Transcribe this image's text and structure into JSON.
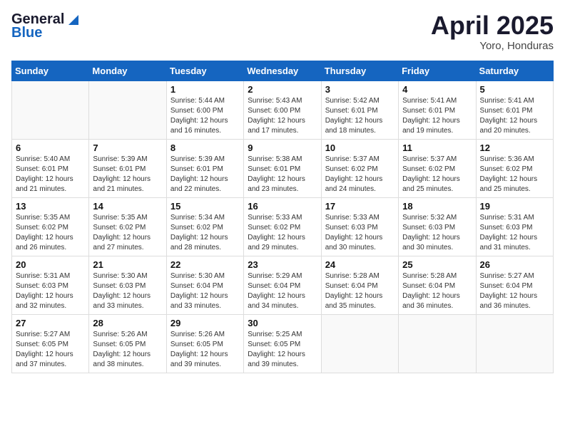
{
  "header": {
    "logo_general": "General",
    "logo_blue": "Blue",
    "month_title": "April 2025",
    "location": "Yoro, Honduras"
  },
  "days_of_week": [
    "Sunday",
    "Monday",
    "Tuesday",
    "Wednesday",
    "Thursday",
    "Friday",
    "Saturday"
  ],
  "weeks": [
    [
      {
        "day": "",
        "content": ""
      },
      {
        "day": "",
        "content": ""
      },
      {
        "day": "1",
        "content": "Sunrise: 5:44 AM\nSunset: 6:00 PM\nDaylight: 12 hours and 16 minutes."
      },
      {
        "day": "2",
        "content": "Sunrise: 5:43 AM\nSunset: 6:00 PM\nDaylight: 12 hours and 17 minutes."
      },
      {
        "day": "3",
        "content": "Sunrise: 5:42 AM\nSunset: 6:01 PM\nDaylight: 12 hours and 18 minutes."
      },
      {
        "day": "4",
        "content": "Sunrise: 5:41 AM\nSunset: 6:01 PM\nDaylight: 12 hours and 19 minutes."
      },
      {
        "day": "5",
        "content": "Sunrise: 5:41 AM\nSunset: 6:01 PM\nDaylight: 12 hours and 20 minutes."
      }
    ],
    [
      {
        "day": "6",
        "content": "Sunrise: 5:40 AM\nSunset: 6:01 PM\nDaylight: 12 hours and 21 minutes."
      },
      {
        "day": "7",
        "content": "Sunrise: 5:39 AM\nSunset: 6:01 PM\nDaylight: 12 hours and 21 minutes."
      },
      {
        "day": "8",
        "content": "Sunrise: 5:39 AM\nSunset: 6:01 PM\nDaylight: 12 hours and 22 minutes."
      },
      {
        "day": "9",
        "content": "Sunrise: 5:38 AM\nSunset: 6:01 PM\nDaylight: 12 hours and 23 minutes."
      },
      {
        "day": "10",
        "content": "Sunrise: 5:37 AM\nSunset: 6:02 PM\nDaylight: 12 hours and 24 minutes."
      },
      {
        "day": "11",
        "content": "Sunrise: 5:37 AM\nSunset: 6:02 PM\nDaylight: 12 hours and 25 minutes."
      },
      {
        "day": "12",
        "content": "Sunrise: 5:36 AM\nSunset: 6:02 PM\nDaylight: 12 hours and 25 minutes."
      }
    ],
    [
      {
        "day": "13",
        "content": "Sunrise: 5:35 AM\nSunset: 6:02 PM\nDaylight: 12 hours and 26 minutes."
      },
      {
        "day": "14",
        "content": "Sunrise: 5:35 AM\nSunset: 6:02 PM\nDaylight: 12 hours and 27 minutes."
      },
      {
        "day": "15",
        "content": "Sunrise: 5:34 AM\nSunset: 6:02 PM\nDaylight: 12 hours and 28 minutes."
      },
      {
        "day": "16",
        "content": "Sunrise: 5:33 AM\nSunset: 6:02 PM\nDaylight: 12 hours and 29 minutes."
      },
      {
        "day": "17",
        "content": "Sunrise: 5:33 AM\nSunset: 6:03 PM\nDaylight: 12 hours and 30 minutes."
      },
      {
        "day": "18",
        "content": "Sunrise: 5:32 AM\nSunset: 6:03 PM\nDaylight: 12 hours and 30 minutes."
      },
      {
        "day": "19",
        "content": "Sunrise: 5:31 AM\nSunset: 6:03 PM\nDaylight: 12 hours and 31 minutes."
      }
    ],
    [
      {
        "day": "20",
        "content": "Sunrise: 5:31 AM\nSunset: 6:03 PM\nDaylight: 12 hours and 32 minutes."
      },
      {
        "day": "21",
        "content": "Sunrise: 5:30 AM\nSunset: 6:03 PM\nDaylight: 12 hours and 33 minutes."
      },
      {
        "day": "22",
        "content": "Sunrise: 5:30 AM\nSunset: 6:04 PM\nDaylight: 12 hours and 33 minutes."
      },
      {
        "day": "23",
        "content": "Sunrise: 5:29 AM\nSunset: 6:04 PM\nDaylight: 12 hours and 34 minutes."
      },
      {
        "day": "24",
        "content": "Sunrise: 5:28 AM\nSunset: 6:04 PM\nDaylight: 12 hours and 35 minutes."
      },
      {
        "day": "25",
        "content": "Sunrise: 5:28 AM\nSunset: 6:04 PM\nDaylight: 12 hours and 36 minutes."
      },
      {
        "day": "26",
        "content": "Sunrise: 5:27 AM\nSunset: 6:04 PM\nDaylight: 12 hours and 36 minutes."
      }
    ],
    [
      {
        "day": "27",
        "content": "Sunrise: 5:27 AM\nSunset: 6:05 PM\nDaylight: 12 hours and 37 minutes."
      },
      {
        "day": "28",
        "content": "Sunrise: 5:26 AM\nSunset: 6:05 PM\nDaylight: 12 hours and 38 minutes."
      },
      {
        "day": "29",
        "content": "Sunrise: 5:26 AM\nSunset: 6:05 PM\nDaylight: 12 hours and 39 minutes."
      },
      {
        "day": "30",
        "content": "Sunrise: 5:25 AM\nSunset: 6:05 PM\nDaylight: 12 hours and 39 minutes."
      },
      {
        "day": "",
        "content": ""
      },
      {
        "day": "",
        "content": ""
      },
      {
        "day": "",
        "content": ""
      }
    ]
  ]
}
